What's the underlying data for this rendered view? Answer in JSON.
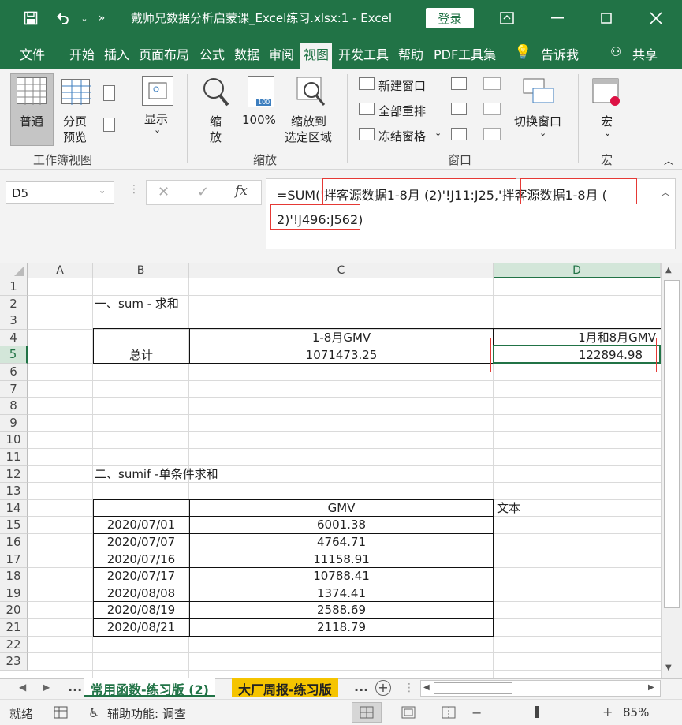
{
  "window": {
    "title": "戴师兄数据分析启蒙课_Excel练习.xlsx:1  -  Excel",
    "login": "登录"
  },
  "tabs": [
    "文件",
    "开始",
    "插入",
    "页面布局",
    "公式",
    "数据",
    "审阅",
    "视图",
    "开发工具",
    "帮助",
    "PDF工具集",
    "告诉我",
    "共享"
  ],
  "ribbon": {
    "normal": "普通",
    "page_break": "分页",
    "page_break2": "预览",
    "show": "显示",
    "zoom": "缩",
    "zoom2": "放",
    "zoom100": "100%",
    "zoom_sel": "缩放到",
    "zoom_sel2": "选定区域",
    "new_window": "新建窗口",
    "arrange_all": "全部重排",
    "freeze": "冻结窗格",
    "switch_window": "切换窗口",
    "macro": "宏",
    "group_workbook_views": "工作簿视图",
    "group_zoom": "缩放",
    "group_window": "窗口",
    "group_macro": "宏"
  },
  "namebox": "D5",
  "formula": {
    "line1": "=SUM('拌客源数据1-8月 (2)'!J11:J25,'拌客源数据1-8月 (",
    "line2": "2)'!J496:J562)"
  },
  "columns": [
    "A",
    "B",
    "C",
    "D"
  ],
  "rows": [
    "1",
    "2",
    "3",
    "4",
    "5",
    "6",
    "7",
    "8",
    "9",
    "10",
    "11",
    "12",
    "13",
    "14",
    "15",
    "16",
    "17",
    "18",
    "19",
    "20",
    "21",
    "22",
    "23"
  ],
  "cells": {
    "b2": "一、sum - 求和",
    "c4": "1-8月GMV",
    "d4": "1月和8月GMV",
    "b5": "总计",
    "c5": "1071473.25",
    "d5": "122894.98",
    "b12": "二、sumif -单条件求和",
    "c14": "GMV",
    "d14": "文本",
    "dates": [
      "2020/07/01",
      "2020/07/07",
      "2020/07/16",
      "2020/07/17",
      "2020/08/08",
      "2020/08/19",
      "2020/08/21"
    ],
    "gmv": [
      "6001.38",
      "4764.71",
      "11158.91",
      "10788.41",
      "1374.41",
      "2588.69",
      "2118.79"
    ]
  },
  "sheets": {
    "dots": "...",
    "tab1": "常用函数-练习版 (2)",
    "tab2": "大厂周报-练习版",
    "dots2": "..."
  },
  "status": {
    "ready": "就绪",
    "accessibility": "辅助功能: 调查",
    "zoom": "85%"
  },
  "colors": {
    "excel_green": "#217346",
    "sheet_tab2_bg": "#f5c400",
    "highlight_red": "#e53935"
  }
}
